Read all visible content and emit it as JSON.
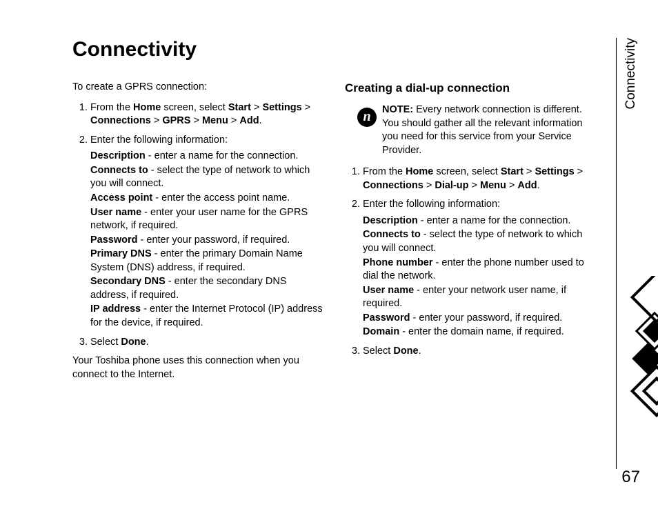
{
  "section_label": "Connectivity",
  "page_number": "67",
  "title": "Connectivity",
  "left": {
    "intro": "To create a GPRS connection:",
    "steps": {
      "s1": {
        "pre": "From the ",
        "home": "Home",
        "mid1": " screen, select ",
        "start": "Start",
        "gt1": " > ",
        "settings": "Settings",
        "gt2": " > ",
        "connections": "Connections",
        "gt3": " > ",
        "gprs": "GPRS",
        "gt4": " > ",
        "menu": "Menu",
        "gt5": " > ",
        "add": "Add",
        "end": "."
      },
      "s2": {
        "lead": "Enter the following information:",
        "f_desc_b": "Description",
        "f_desc": " - enter a name for the connection.",
        "f_conn_b": "Connects to",
        "f_conn": " - select the type of network to which you will connect.",
        "f_ap_b": "Access point",
        "f_ap": " - enter the access point name.",
        "f_user_b": "User name",
        "f_user": " - enter your user name for the GPRS network, if required.",
        "f_pass_b": "Password",
        "f_pass": " - enter your password, if required.",
        "f_pdns_b": "Primary DNS",
        "f_pdns": " - enter the primary Domain Name System (DNS) address, if required.",
        "f_sdns_b": "Secondary DNS",
        "f_sdns": " - enter the secondary DNS address, if required.",
        "f_ip_b": "IP address",
        "f_ip": " - enter the Internet Protocol (IP) address for the device, if required."
      },
      "s3": {
        "pre": "Select ",
        "done": "Done",
        "end": "."
      }
    },
    "closing": "Your Toshiba phone uses this connection when you connect to the Internet."
  },
  "right": {
    "heading": "Creating a dial-up connection",
    "note_label": "NOTE:",
    "note_body": " Every network connection is different. You should gather all the relevant information you need for this service from your Service Provider.",
    "note_icon": "n",
    "steps": {
      "s1": {
        "pre": "From the ",
        "home": "Home",
        "mid1": " screen, select ",
        "start": "Start",
        "gt1": " > ",
        "settings": "Settings",
        "gt2": " > ",
        "connections": "Connections",
        "gt3": " > ",
        "dialup": "Dial-up",
        "gt4": " > ",
        "menu": "Menu",
        "gt5": " > ",
        "add": "Add",
        "end": "."
      },
      "s2": {
        "lead": "Enter the following information:",
        "f_desc_b": "Description",
        "f_desc": " - enter a name for the connection.",
        "f_conn_b": "Connects to",
        "f_conn": " - select the type of network to which you will connect.",
        "f_phone_b": "Phone number",
        "f_phone": " - enter the phone number used to dial the network.",
        "f_user_b": "User name",
        "f_user": " - enter your network user name, if required.",
        "f_pass_b": "Password",
        "f_pass": " - enter your password, if required.",
        "f_domain_b": "Domain",
        "f_domain": " - enter the domain name, if required."
      },
      "s3": {
        "pre": "Select ",
        "done": "Done",
        "end": "."
      }
    }
  }
}
